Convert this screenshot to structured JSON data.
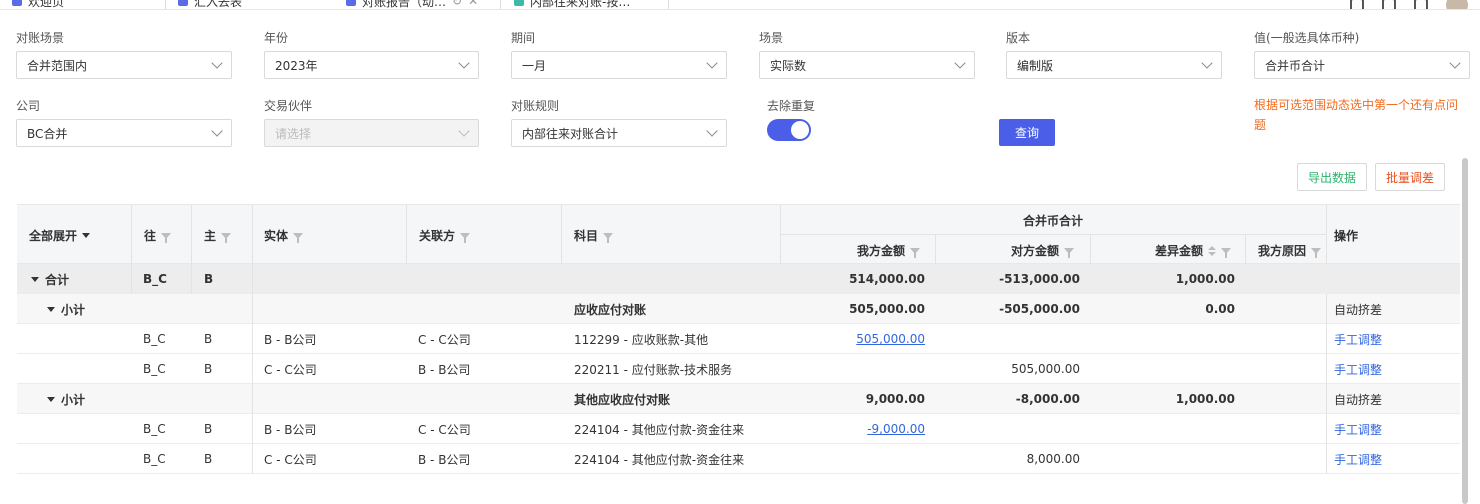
{
  "tabs": [
    {
      "label": "欢迎页"
    },
    {
      "label": "汇入去表"
    },
    {
      "label": "对账报告（动…"
    },
    {
      "label": "内部往来对账-按…"
    }
  ],
  "filters": {
    "scene": {
      "label": "对账场景",
      "value": "合并范围内"
    },
    "year": {
      "label": "年份",
      "value": "2023年"
    },
    "period": {
      "label": "期间",
      "value": "一月"
    },
    "scenario": {
      "label": "场景",
      "value": "实际数"
    },
    "version": {
      "label": "版本",
      "value": "编制版"
    },
    "value_currency": {
      "label": "值(一般选具体币种)",
      "value": "合并币合计"
    },
    "company": {
      "label": "公司",
      "value": "BC合并"
    },
    "partner": {
      "label": "交易伙伴",
      "placeholder": "请选择"
    },
    "rule": {
      "label": "对账规则",
      "value": "内部往来对账合计"
    },
    "dedupe": {
      "label": "去除重复",
      "on": true
    }
  },
  "query_label": "查询",
  "note": "根据可选范围动态选中第一个还有点问题",
  "export_label": "导出数据",
  "batch_adjust_label": "批量调差",
  "table": {
    "headers": {
      "expand_all": "全部展开",
      "wang": "往",
      "zhu": "主",
      "entity": "实体",
      "related": "关联方",
      "account": "科目",
      "group": "合并币合计",
      "my_amount": "我方金额",
      "other_amount": "对方金额",
      "diff_amount": "差异金额",
      "my_reason": "我方原因",
      "ops": "操作"
    },
    "total": {
      "label": "合计",
      "wang": "B_C",
      "zhu": "B",
      "my_amount": "514,000.00",
      "other_amount": "-513,000.00",
      "diff": "1,000.00"
    },
    "groups": [
      {
        "subtotal": {
          "label": "小计",
          "account": "应收应付对账",
          "my_amount": "505,000.00",
          "other_amount": "-505,000.00",
          "diff": "0.00",
          "op": "自动挤差"
        },
        "rows": [
          {
            "wang": "B_C",
            "zhu": "B",
            "entity": "B - B公司",
            "related": "C - C公司",
            "account": "112299 - 应收账款-其他",
            "my_amount": "505,000.00",
            "other_amount": "",
            "op": "手工调整"
          },
          {
            "wang": "B_C",
            "zhu": "B",
            "entity": "C - C公司",
            "related": "B - B公司",
            "account": "220211 - 应付账款-技术服务",
            "my_amount": "",
            "other_amount": "505,000.00",
            "op": "手工调整"
          }
        ]
      },
      {
        "subtotal": {
          "label": "小计",
          "account": "其他应收应付对账",
          "my_amount": "9,000.00",
          "other_amount": "-8,000.00",
          "diff": "1,000.00",
          "op": "自动挤差"
        },
        "rows": [
          {
            "wang": "B_C",
            "zhu": "B",
            "entity": "B - B公司",
            "related": "C - C公司",
            "account": "224104 - 其他应付款-资金往来",
            "my_amount": "-9,000.00",
            "other_amount": "",
            "op": "手工调整"
          },
          {
            "wang": "B_C",
            "zhu": "B",
            "entity": "C - C公司",
            "related": "B - B公司",
            "account": "224104 - 其他应付款-资金往来",
            "my_amount": "",
            "other_amount": "8,000.00",
            "op": "手工调整"
          }
        ]
      }
    ]
  }
}
